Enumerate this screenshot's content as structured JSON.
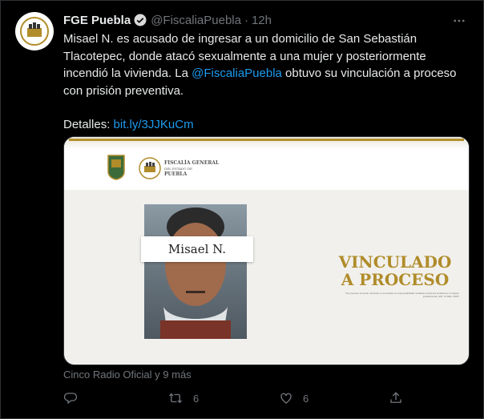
{
  "tweet": {
    "author_name": "FGE Puebla",
    "handle": "@FiscaliaPuebla",
    "separator": "·",
    "time": "12h",
    "text": {
      "line1": "Misael N. es acusado de ingresar a un domicilio de San Sebastián Tlacotepec, donde atacó sexualmente a una mujer y posteriormente incendió la vivienda. La ",
      "mention": "@FiscaliaPuebla",
      "line2": " obtuvo su vinculación a proceso con prisión preventiva.",
      "details_label": "Detalles: ",
      "details_link": "bit.ly/3JJKuCm"
    },
    "media": {
      "org_line1": "FISCALÍA GENERAL",
      "org_line2": "DEL ESTADO DE",
      "org_line3": "PUEBLA",
      "person_label": "Misael N.",
      "status_line1": "VINCULADO",
      "status_line2": "A PROCESO",
      "fine_print": "*Se presume inocente mientras no se declare su responsabilidad mediante sentencia emitida por el órgano jurisdiccional. ART. 13 DEL CNPP"
    },
    "meta": "Cinco Radio Oficial y 9 más",
    "actions": {
      "retweets": "6",
      "likes": "6"
    }
  },
  "colors": {
    "background": "#000000",
    "link": "#1d9bf0",
    "gold": "#b08c2a",
    "muted": "#71767b"
  },
  "icons": [
    "verified-badge-icon",
    "more-icon",
    "reply-icon",
    "retweet-icon",
    "like-icon",
    "share-icon"
  ]
}
